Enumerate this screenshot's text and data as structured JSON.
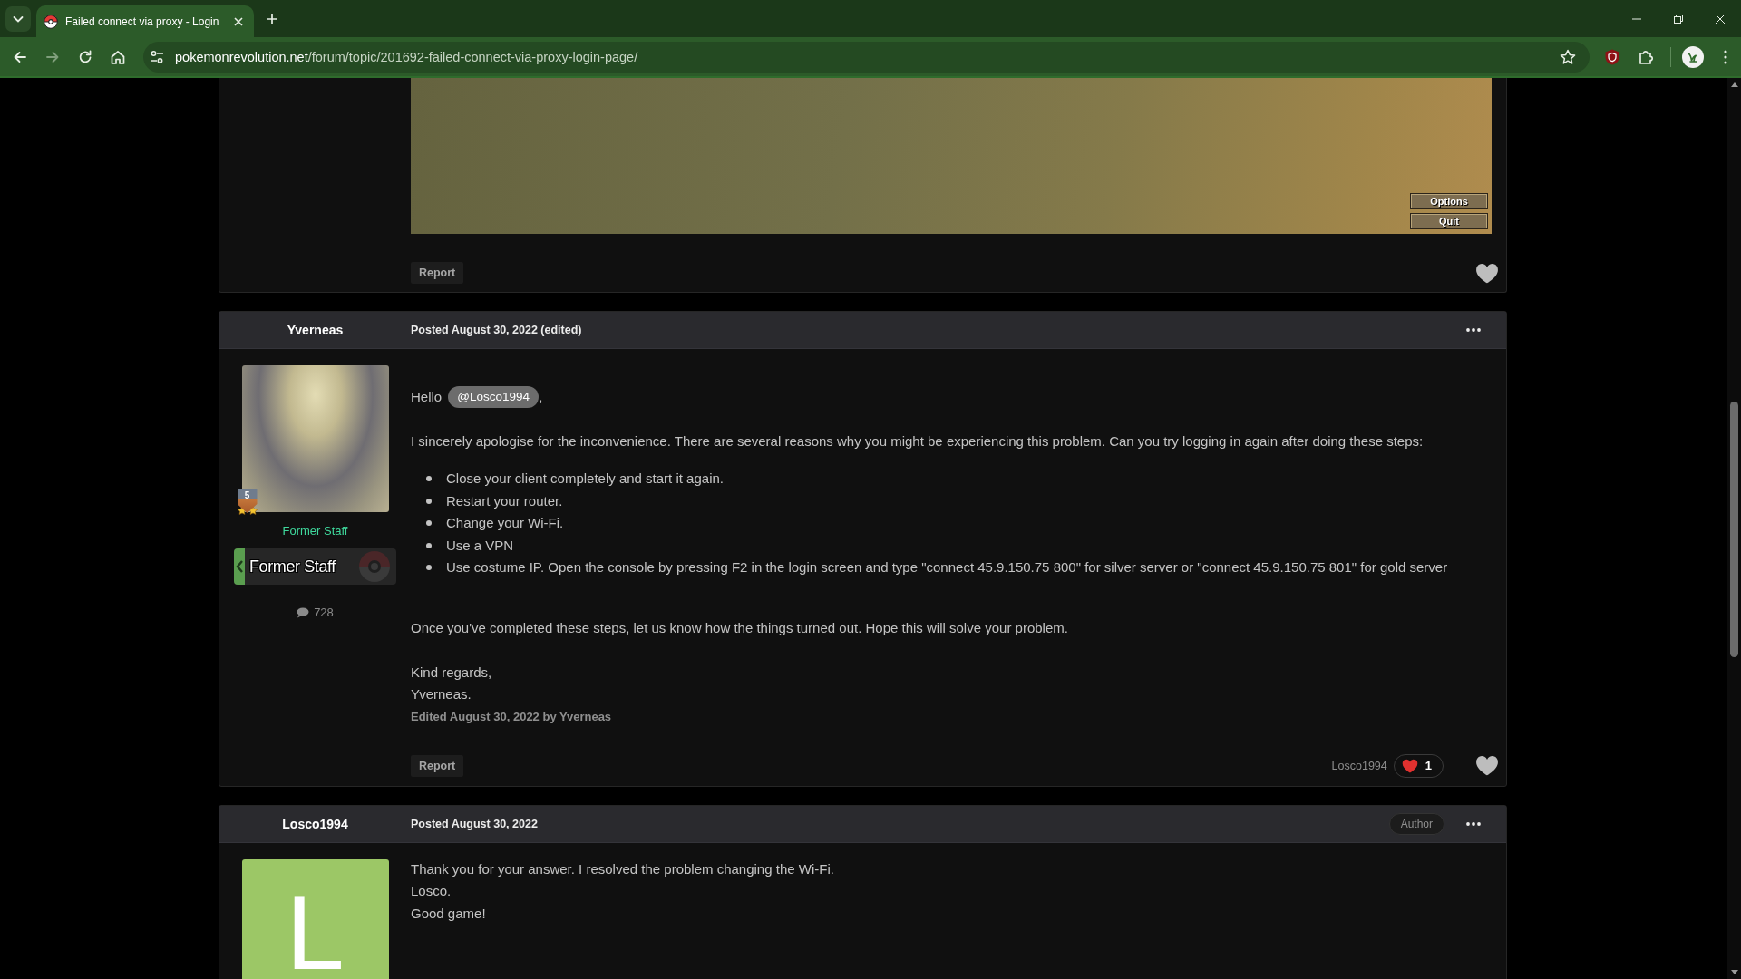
{
  "browser": {
    "tabs": [
      {
        "title": "Failed connect via proxy - Login",
        "selected": true
      }
    ],
    "nav_buttons": [
      {
        "kind": "back",
        "disabled": false
      },
      {
        "kind": "forward",
        "disabled": true
      },
      {
        "kind": "reload",
        "disabled": false
      },
      {
        "kind": "home",
        "disabled": false
      }
    ],
    "address": {
      "domain": "pokemonrevolution.net",
      "path": "/forum/topic/201692-failed-connect-via-proxy-login-page/"
    }
  },
  "posts": [
    {
      "kind": "continued",
      "screenshot": {
        "buttons": [
          "Options",
          "Quit"
        ]
      },
      "report": "Report"
    },
    {
      "kind": "full",
      "author": "Yverneas",
      "posted": "Posted August 30, 2022 (edited)",
      "avatar": {
        "kind": "photo",
        "rank": "5"
      },
      "group": "Former Staff",
      "group_banner": "Former Staff",
      "post_count": "728",
      "body": [
        {
          "kind": "greeting",
          "text": "Hello",
          "mention": "@Losco1994",
          "after": ","
        },
        {
          "kind": "paragraph",
          "text": "I sincerely apologise for the inconvenience. There are several reasons why you might be experiencing this problem. Can you try logging in again after doing these steps:"
        },
        {
          "kind": "list",
          "items": [
            "Close your client completely and start it again.",
            "Restart your router.",
            "Change your Wi-Fi.",
            "Use a VPN",
            "Use costume IP. Open the console by pressing F2 in the login screen and type \"connect 45.9.150.75 800\" for silver server or \"connect 45.9.150.75 801\" for gold server"
          ]
        },
        {
          "kind": "paragraph",
          "text": "Once you've completed these steps, let us know how the things turned out. Hope this will solve your problem."
        },
        {
          "kind": "lines",
          "lines": [
            "Kind regards,",
            "Yverneas."
          ]
        }
      ],
      "edited": "Edited August 30, 2022 by Yverneas",
      "report": "Report",
      "reactions": {
        "user": "Losco1994",
        "count": "1"
      }
    },
    {
      "kind": "full",
      "author": "Losco1994",
      "posted": "Posted August 30, 2022",
      "badge": "Author",
      "avatar": {
        "kind": "letter",
        "letter": "L"
      },
      "body": [
        {
          "kind": "lines",
          "lines": [
            "Thank you for your answer. I resolved the problem changing the Wi-Fi.",
            "Losco.",
            "Good game!"
          ]
        }
      ]
    }
  ]
}
